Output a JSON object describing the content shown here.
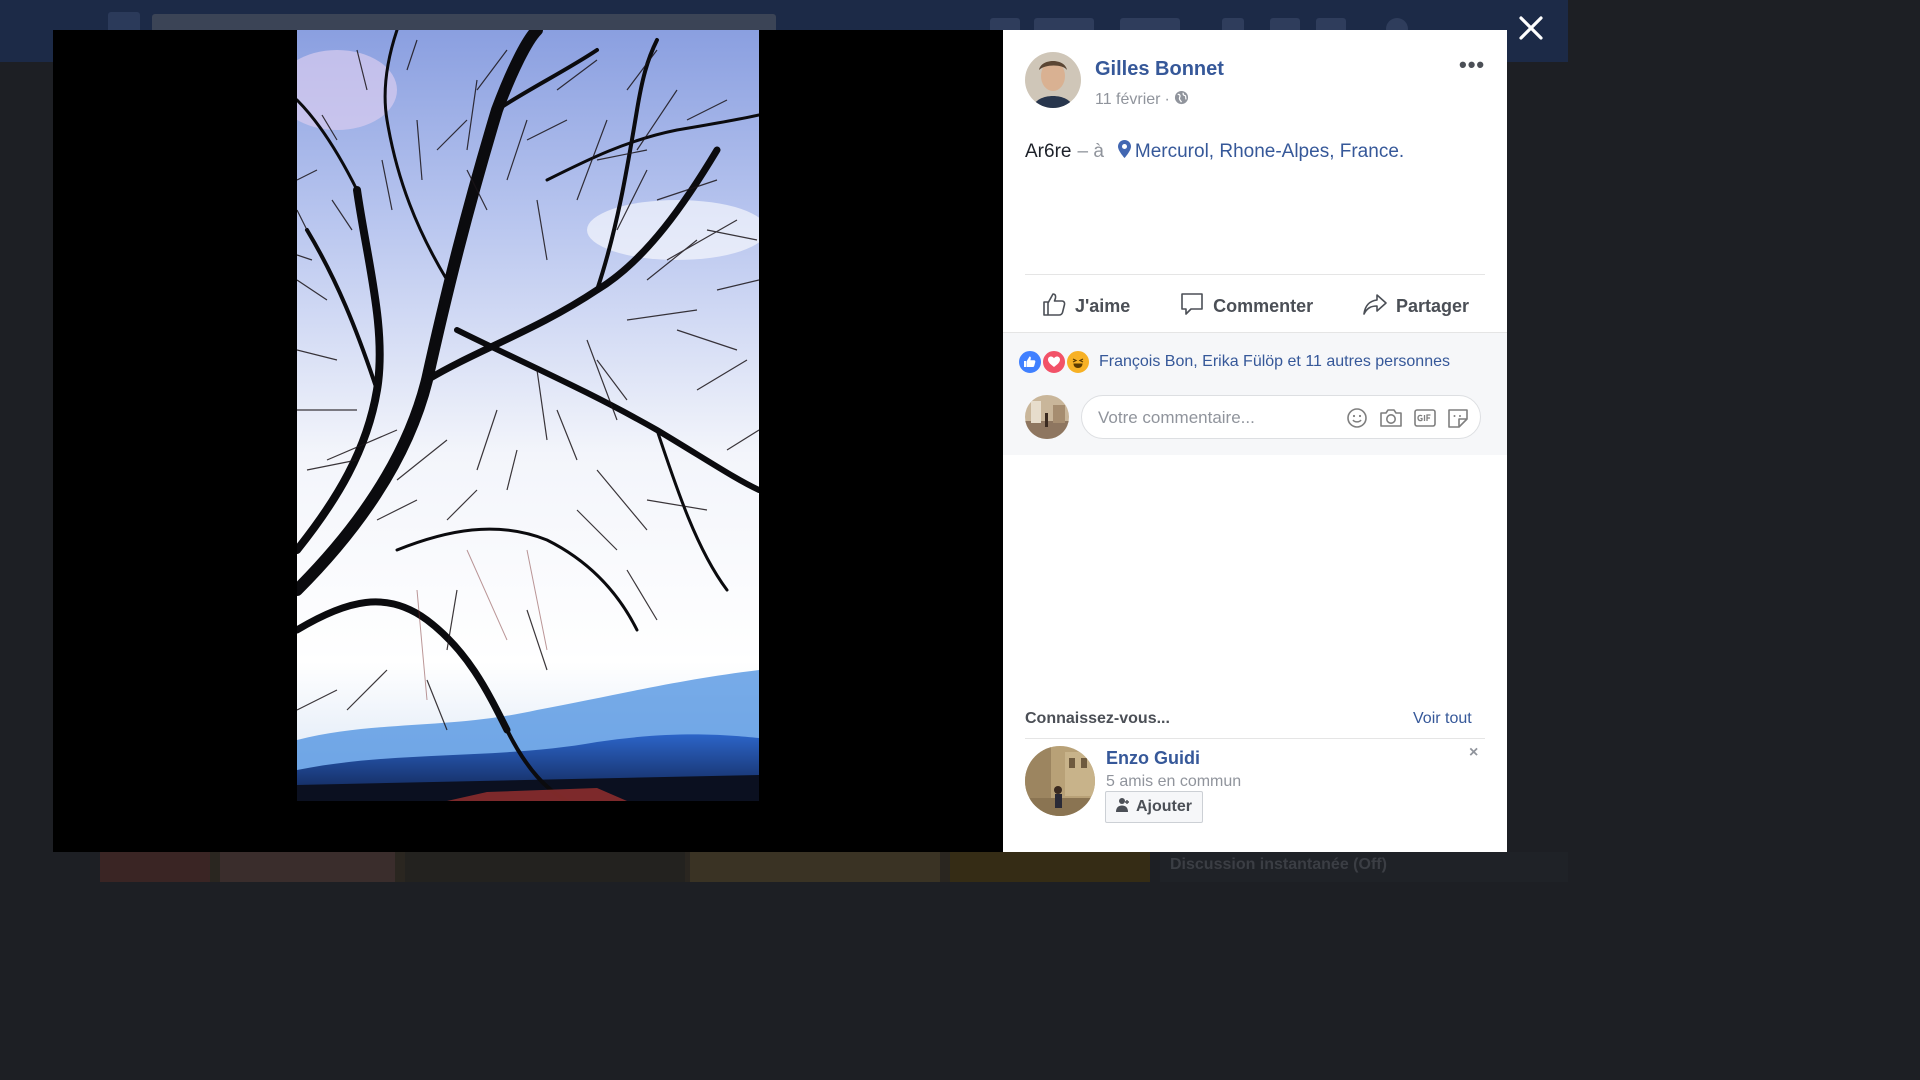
{
  "background": {
    "chat_label": "Discussion instantanée (Off)"
  },
  "viewer": {
    "close_icon": "close-icon"
  },
  "post": {
    "author": "Gilles Bonnet",
    "date": "11 février",
    "date_separator": "·",
    "privacy_icon": "globe-icon",
    "more_label": "•••",
    "caption_text": "Ar6re",
    "caption_separator": "– à",
    "location": "Mercurol, Rhone-Alpes, France",
    "location_period": "."
  },
  "actions": {
    "like_label": "J'aime",
    "comment_label": "Commenter",
    "share_label": "Partager"
  },
  "reactions": {
    "icons": [
      "like-icon",
      "love-icon",
      "haha-icon"
    ],
    "summary": "François Bon, Erika Fülöp et 11 autres personnes"
  },
  "comment": {
    "placeholder": "Votre commentaire...",
    "tools": [
      "emoji-icon",
      "camera-icon",
      "gif-icon",
      "sticker-icon"
    ]
  },
  "pymk": {
    "title": "Connaissez-vous...",
    "see_all": "Voir tout",
    "person": {
      "name": "Enzo Guidi",
      "mutual": "5 amis en commun",
      "add_label": "Ajouter",
      "dismiss": "×"
    }
  },
  "colors": {
    "brand_link": "#365899",
    "muted": "#90949c",
    "overlay": "#000000",
    "like_blue": "#4080ff",
    "love_red": "#f25268",
    "haha_yellow": "#f7b125"
  }
}
